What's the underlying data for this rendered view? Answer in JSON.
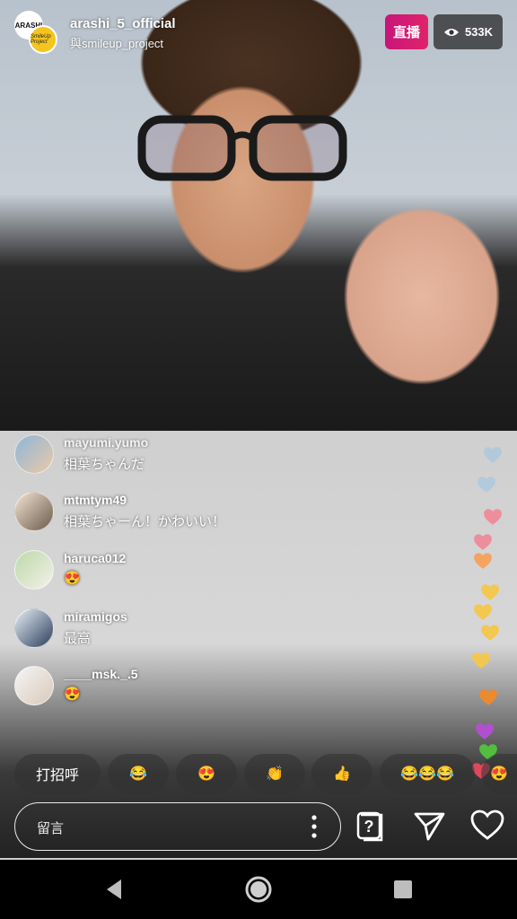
{
  "header": {
    "avatar_text": "ARASHI",
    "avatar2_text": "SmileUp Project",
    "username": "arashi_5_official",
    "with_text": "與smileup_project",
    "live_label": "直播",
    "viewer_count": "533K"
  },
  "comments": [
    {
      "user": "mayumi.yumo",
      "text": "相葉ちゃんだ"
    },
    {
      "user": "mtmtym49",
      "text": "相葉ちゃーん！かわいい！"
    },
    {
      "user": "haruca012",
      "text": "😍"
    },
    {
      "user": "miramigos",
      "text": "最高"
    },
    {
      "user": "____msk._.5",
      "text": "😍"
    }
  ],
  "quick_reactions": [
    "打招呼",
    "😂",
    "😍",
    "👏",
    "👍",
    "😂😂😂",
    "😍"
  ],
  "comment_bar": {
    "placeholder": "留言"
  },
  "colors": {
    "live": "#d81b72",
    "hearts": [
      "#a9c7e0",
      "#a9c7e0",
      "#f08a9a",
      "#f08a9a",
      "#f5a25a",
      "#f5c84a",
      "#f5c84a",
      "#f5c84a",
      "#f5c84a",
      "#f08a2a",
      "#b44fd6",
      "#53c43c",
      "#e84a5f"
    ]
  },
  "icons": [
    "eye-icon",
    "question-icon",
    "send-icon",
    "heart-icon",
    "back-icon",
    "home-icon",
    "recents-icon",
    "more-icon"
  ]
}
